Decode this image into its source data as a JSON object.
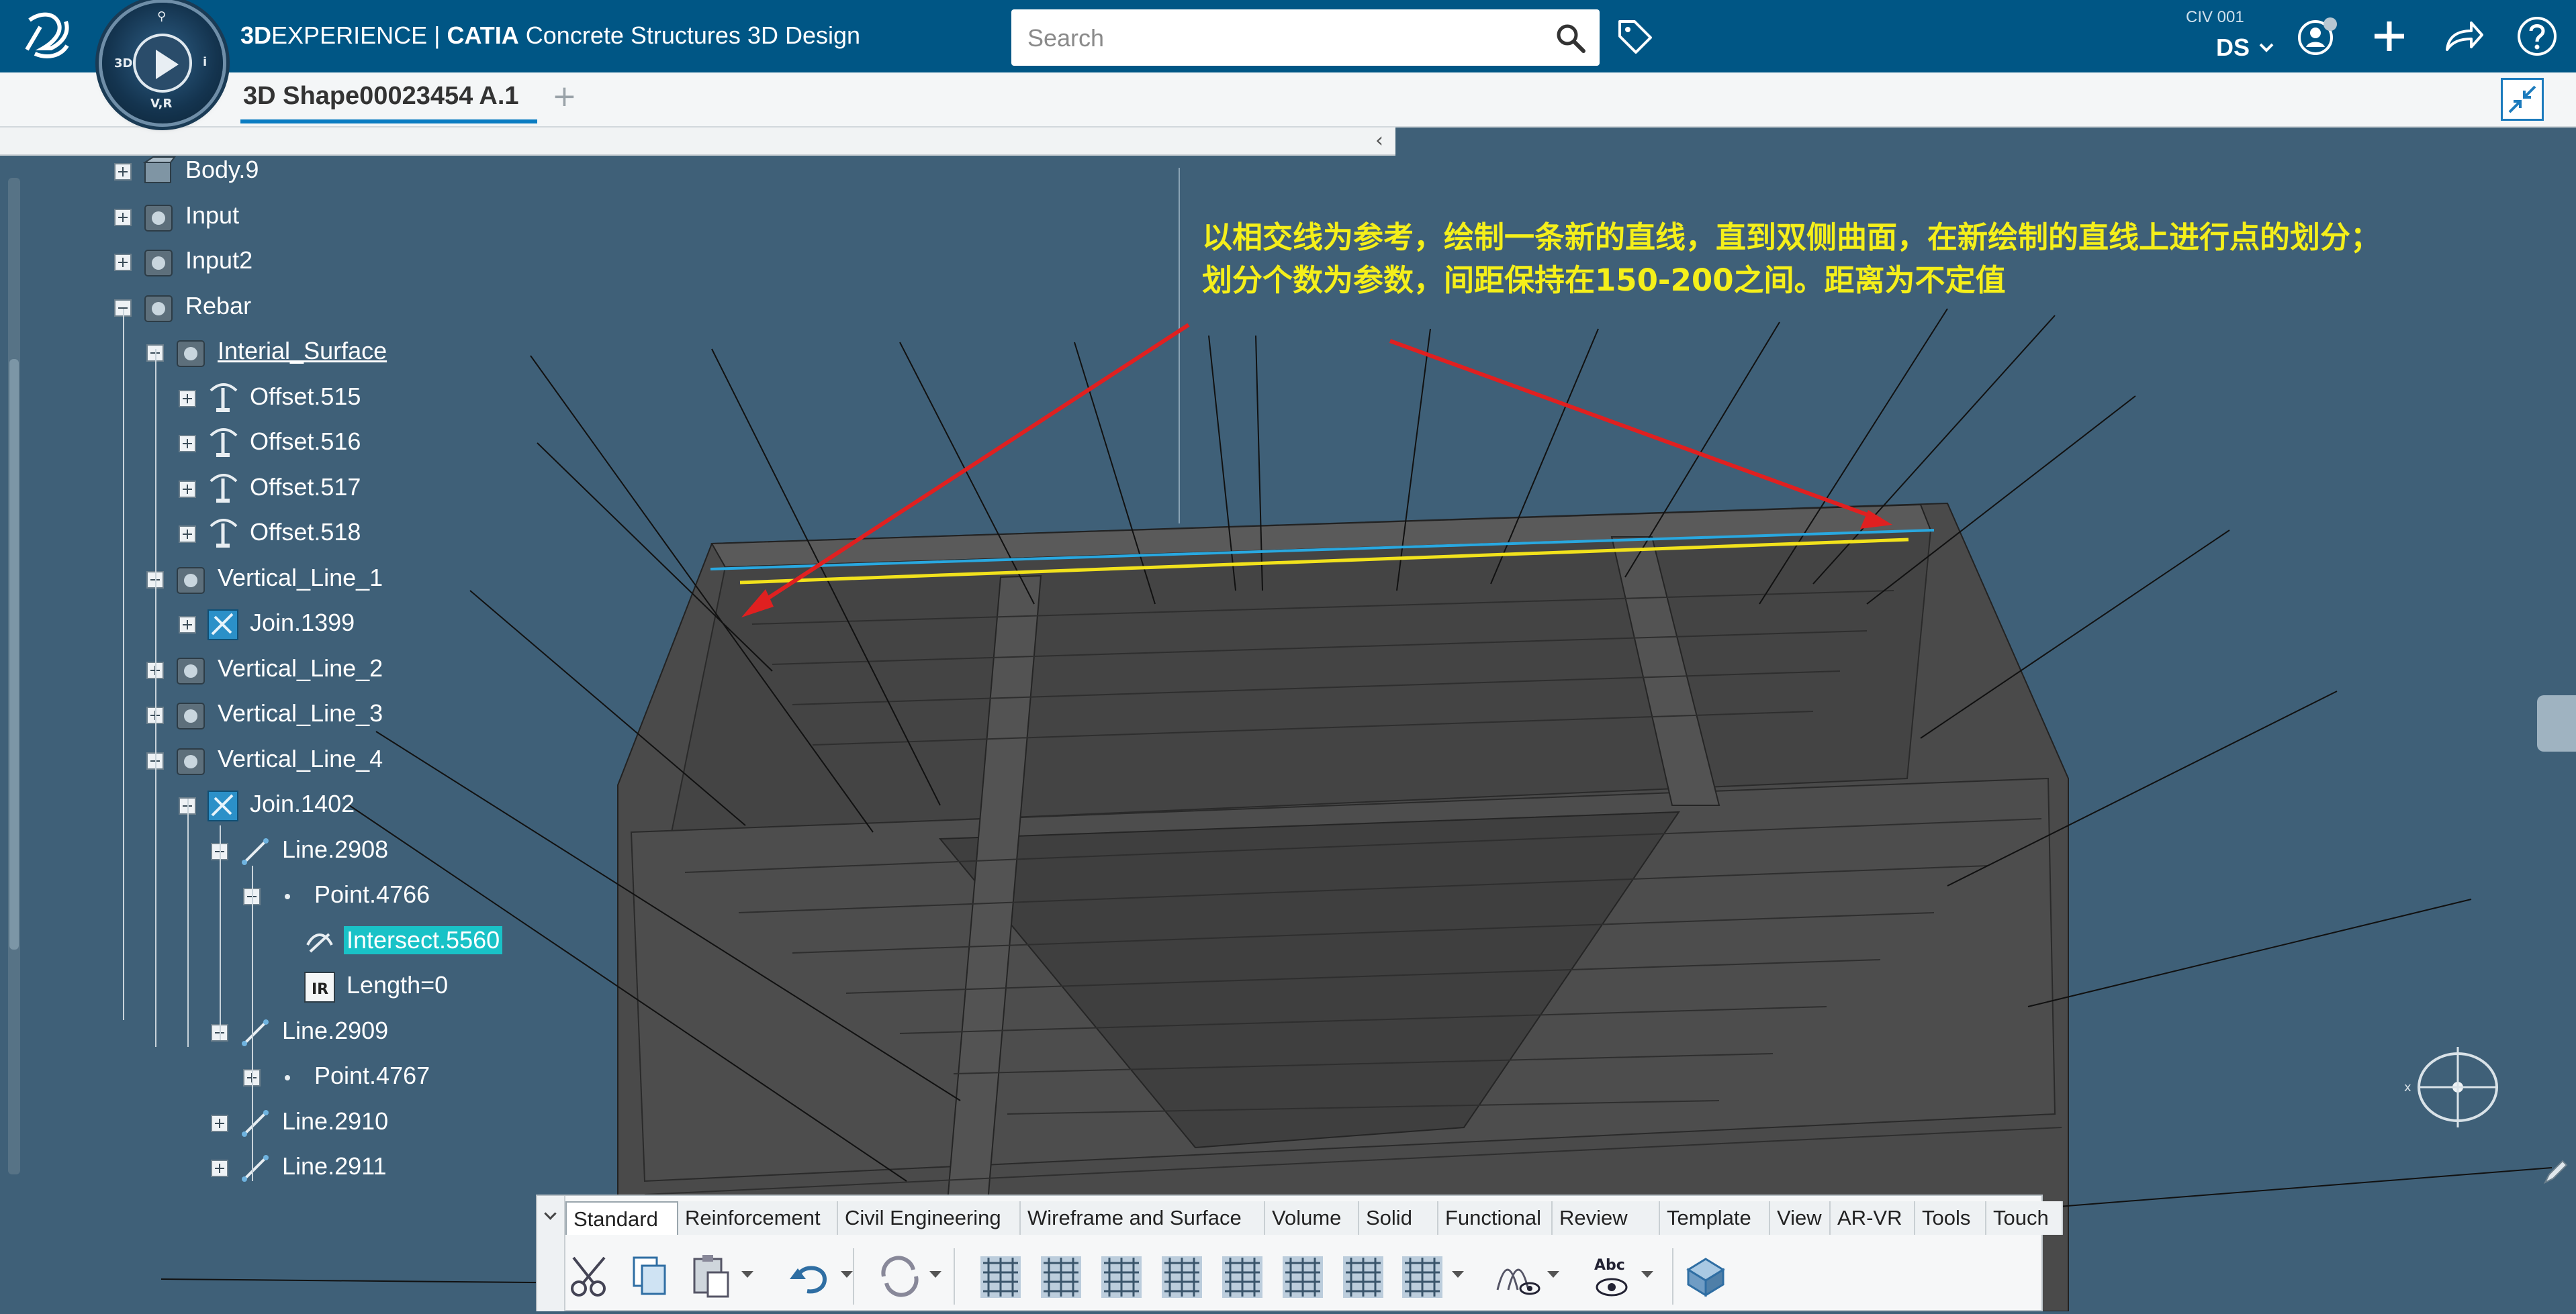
{
  "app": {
    "brand_bold": "3D",
    "brand_rest": "EXPERIENCE | ",
    "brand_catia": "CATIA",
    "app_name": " Concrete Structures 3D Design",
    "compass_labels": {
      "top": "⚲",
      "left": "3D",
      "right": "i",
      "bottom": "V,R"
    }
  },
  "search": {
    "placeholder": "Search"
  },
  "user": {
    "collab_space": "CIV 001",
    "initials": "DS"
  },
  "document_tab": {
    "title": "3D Shape00023454 A.1",
    "add": "+"
  },
  "tree_panel": {
    "collapse_glyph": "‹"
  },
  "tree": [
    {
      "label": "Body.9",
      "expander": "plus",
      "icon": "body-icon"
    },
    {
      "label": "Input",
      "expander": "plus",
      "icon": "geometric-set-icon"
    },
    {
      "label": "Input2",
      "expander": "plus",
      "icon": "geometric-set-icon"
    },
    {
      "label": "Rebar",
      "expander": "minus",
      "icon": "geometric-set-icon"
    },
    {
      "label": "Interial_Surface",
      "expander": "minus",
      "icon": "geometric-set-icon",
      "underline": true
    },
    {
      "label": "Offset.515",
      "expander": "plus",
      "icon": "offset-icon"
    },
    {
      "label": "Offset.516",
      "expander": "plus",
      "icon": "offset-icon"
    },
    {
      "label": "Offset.517",
      "expander": "plus",
      "icon": "offset-icon"
    },
    {
      "label": "Offset.518",
      "expander": "plus",
      "icon": "offset-icon"
    },
    {
      "label": "Vertical_Line_1",
      "expander": "minus",
      "icon": "geometric-set-icon"
    },
    {
      "label": "Join.1399",
      "expander": "plus",
      "icon": "join-icon"
    },
    {
      "label": "Vertical_Line_2",
      "expander": "plus",
      "icon": "geometric-set-icon"
    },
    {
      "label": "Vertical_Line_3",
      "expander": "plus",
      "icon": "geometric-set-icon"
    },
    {
      "label": "Vertical_Line_4",
      "expander": "minus",
      "icon": "geometric-set-icon"
    },
    {
      "label": "Join.1402",
      "expander": "minus",
      "icon": "join-icon"
    },
    {
      "label": "Line.2908",
      "expander": "minus",
      "icon": "line-icon"
    },
    {
      "label": "Point.4766",
      "expander": "minus",
      "icon": "point-icon"
    },
    {
      "label": "Intersect.5560",
      "expander": "none",
      "icon": "intersect-icon",
      "selected": true
    },
    {
      "label": "Length=0",
      "expander": "none",
      "icon": "parameter-icon"
    },
    {
      "label": "Line.2909",
      "expander": "minus",
      "icon": "line-icon"
    },
    {
      "label": "Point.4767",
      "expander": "plus",
      "icon": "point-icon"
    },
    {
      "label": "Line.2910",
      "expander": "plus",
      "icon": "line-icon"
    },
    {
      "label": "Line.2911",
      "expander": "plus",
      "icon": "line-icon"
    }
  ],
  "annotation": {
    "line1": "以相交线为参考，绘制一条新的直线，直到双侧曲面，在新绘制的直线上进行点的划分；",
    "line2": "划分个数为参数，间距保持在150-200之间。距离为不定值",
    "text_color": "#f5ef1a",
    "arrow_color": "#e02020"
  },
  "action_bar": {
    "tabs": [
      "Standard",
      "Reinforcement",
      "Civil Engineering",
      "Wireframe and Surface",
      "Volume",
      "Solid",
      "Functional",
      "Review",
      "Template",
      "View",
      "AR-VR",
      "Tools",
      "Touch"
    ],
    "active_tab": "Standard",
    "tools": [
      "cut-icon",
      "copy-icon",
      "paste-icon",
      "undo-icon",
      "update-icon",
      "rebar-grid-icon",
      "rebar-set-icon",
      "rebar-layout-icon",
      "rebar-bend-icon",
      "rebar-distribution-icon",
      "rebar-cage-icon",
      "rebar-schedule-icon",
      "rebar-pattern-icon",
      "hide-show-icon",
      "spell-view-icon",
      "3d-view-icon"
    ]
  },
  "colors": {
    "topbar": "#005685",
    "viewport_bg": "#3f6078",
    "selection": "#19c2c7",
    "model_dark": "#4a4a4a",
    "highlight_cyan": "#29a8e0",
    "highlight_yellow": "#f2e21c"
  }
}
